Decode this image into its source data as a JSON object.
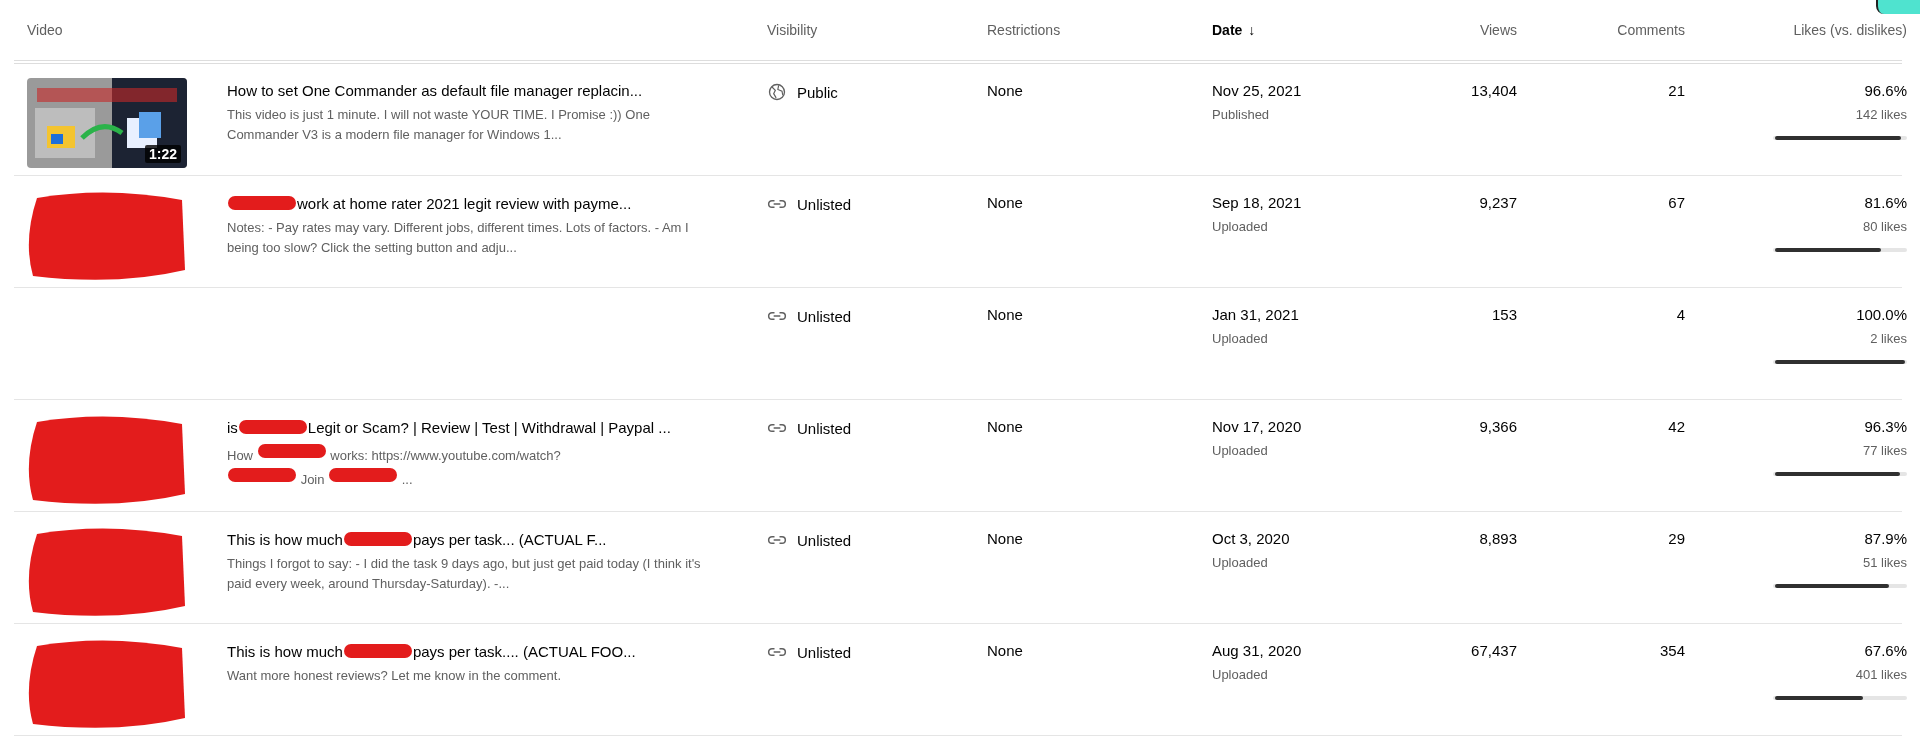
{
  "columns": [
    {
      "label": "Video",
      "sorted": false
    },
    {
      "label": "Visibility",
      "sorted": false
    },
    {
      "label": "Restrictions",
      "sorted": false
    },
    {
      "label": "Date",
      "sorted": true,
      "sort_icon": "↓"
    },
    {
      "label": "Views",
      "sorted": false
    },
    {
      "label": "Comments",
      "sorted": false
    },
    {
      "label": "Likes (vs. dislikes)",
      "sorted": false
    }
  ],
  "rows": [
    {
      "thumbnail": {
        "kind": "picture",
        "duration": "1:22"
      },
      "title": [
        {
          "kind": "text",
          "text": "How to set One Commander as default file manager replacin..."
        }
      ],
      "description": [
        {
          "kind": "text",
          "text": "This video is just 1 minute. I will not waste YOUR TIME. I Promise :)) One Commander V3 is a modern file manager for Windows 1..."
        }
      ],
      "visibility": {
        "kind": "public",
        "label": "Public"
      },
      "restrictions": "None",
      "date": "Nov 25, 2021",
      "date_status": "Published",
      "views": "13,404",
      "comments": "21",
      "likes_percent": "96.6%",
      "likes": "142 likes",
      "level": 0.966
    },
    {
      "thumbnail": {
        "kind": "redacted"
      },
      "title": [
        {
          "kind": "redaction"
        },
        {
          "kind": "text",
          "text": "work at home rater 2021 legit review with payme..."
        }
      ],
      "description": [
        {
          "kind": "text",
          "text": "Notes: - Pay rates may vary. Different jobs, different times. Lots of factors. - Am I being too slow? Click the setting button and adju..."
        }
      ],
      "visibility": {
        "kind": "unlisted",
        "label": "Unlisted"
      },
      "restrictions": "None",
      "date": "Sep 18, 2021",
      "date_status": "Uploaded",
      "views": "9,237",
      "comments": "67",
      "likes_percent": "81.6%",
      "likes": "80 likes",
      "level": 0.816
    },
    {
      "thumbnail": {
        "kind": "none"
      },
      "title": [],
      "description": [],
      "visibility": {
        "kind": "unlisted",
        "label": "Unlisted"
      },
      "restrictions": "None",
      "date": "Jan 31, 2021",
      "date_status": "Uploaded",
      "views": "153",
      "comments": "4",
      "likes_percent": "100.0%",
      "likes": "2 likes",
      "level": 1.0
    },
    {
      "thumbnail": {
        "kind": "redacted"
      },
      "title": [
        {
          "kind": "text",
          "text": "is"
        },
        {
          "kind": "redaction"
        },
        {
          "kind": "text",
          "text": "Legit or Scam? | Review | Test | Withdrawal | Paypal ..."
        }
      ],
      "description": [
        {
          "kind": "text",
          "text": "How"
        },
        {
          "kind": "redaction"
        },
        {
          "kind": "text",
          "text": "works: https://www.youtube.com/watch?"
        },
        {
          "kind": "break"
        },
        {
          "kind": "redaction"
        },
        {
          "kind": "text",
          "text": "Join"
        },
        {
          "kind": "redaction"
        },
        {
          "kind": "text",
          "text": "..."
        }
      ],
      "visibility": {
        "kind": "unlisted",
        "label": "Unlisted"
      },
      "restrictions": "None",
      "date": "Nov 17, 2020",
      "date_status": "Uploaded",
      "views": "9,366",
      "comments": "42",
      "likes_percent": "96.3%",
      "likes": "77 likes",
      "level": 0.963
    },
    {
      "thumbnail": {
        "kind": "redacted"
      },
      "title": [
        {
          "kind": "text",
          "text": "This is how much"
        },
        {
          "kind": "redaction"
        },
        {
          "kind": "text",
          "text": "pays per task... (ACTUAL F..."
        }
      ],
      "description": [
        {
          "kind": "text",
          "text": "Things I forgot to say: - I did the task 9 days ago, but just get paid today (I think it's paid every week, around Thursday-Saturday). -..."
        }
      ],
      "visibility": {
        "kind": "unlisted",
        "label": "Unlisted"
      },
      "restrictions": "None",
      "date": "Oct 3, 2020",
      "date_status": "Uploaded",
      "views": "8,893",
      "comments": "29",
      "likes_percent": "87.9%",
      "likes": "51 likes",
      "level": 0.879
    },
    {
      "thumbnail": {
        "kind": "redacted"
      },
      "title": [
        {
          "kind": "text",
          "text": "This is how much"
        },
        {
          "kind": "redaction"
        },
        {
          "kind": "text",
          "text": "pays per task.... (ACTUAL FOO..."
        }
      ],
      "description": [
        {
          "kind": "text",
          "text": "Want more honest reviews? Let me know in the comment."
        }
      ],
      "visibility": {
        "kind": "unlisted",
        "label": "Unlisted"
      },
      "restrictions": "None",
      "date": "Aug 31, 2020",
      "date_status": "Uploaded",
      "views": "67,437",
      "comments": "354",
      "likes_percent": "67.6%",
      "likes": "401 likes",
      "level": 0.676
    }
  ]
}
